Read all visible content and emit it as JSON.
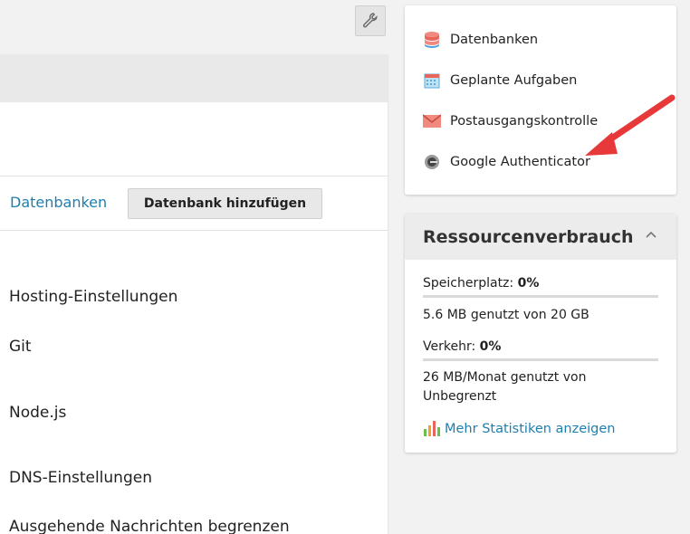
{
  "main": {
    "db_link": "Datenbanken",
    "add_db_button": "Datenbank hinzufügen",
    "settings": [
      "Hosting-Einstellungen",
      "Git",
      "Node.js",
      "DNS-Einstellungen",
      "Ausgehende Nachrichten begrenzen"
    ]
  },
  "quick_links": {
    "items": [
      {
        "label": "Datenbanken",
        "icon": "database-icon"
      },
      {
        "label": "Geplante Aufgaben",
        "icon": "calendar-icon"
      },
      {
        "label": "Postausgangskontrolle",
        "icon": "mail-icon"
      },
      {
        "label": "Google Authenticator",
        "icon": "authenticator-icon"
      }
    ]
  },
  "resources": {
    "title": "Ressourcenverbrauch",
    "storage_label": "Speicherplatz:",
    "storage_pct": "0%",
    "storage_fraction": 0.0,
    "storage_detail": "5.6 MB genutzt von 20 GB",
    "traffic_label": "Verkehr:",
    "traffic_pct": "0%",
    "traffic_fraction": 0.0,
    "traffic_detail_1": "26 MB/Monat genutzt von",
    "traffic_detail_2": "Unbegrenzt",
    "stats_link": "Mehr Statistiken anzeigen"
  },
  "colors": {
    "link": "#1d7fb0",
    "arrow": "#e8393a"
  }
}
